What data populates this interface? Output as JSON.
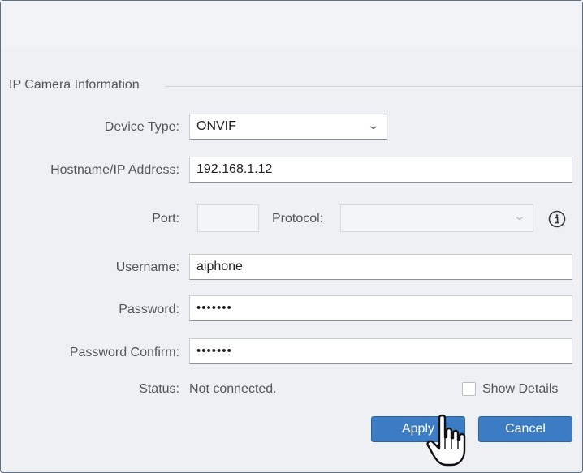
{
  "section": {
    "title": "IP Camera Information"
  },
  "device_type": {
    "label": "Device Type:",
    "value": "ONVIF"
  },
  "hostname": {
    "label": "Hostname/IP Address:",
    "value": "192.168.1.12"
  },
  "port": {
    "label": "Port:",
    "value": ""
  },
  "protocol": {
    "label": "Protocol:",
    "value": ""
  },
  "username": {
    "label": "Username:",
    "value": "aiphone"
  },
  "password": {
    "label": "Password:",
    "value": "•••••••"
  },
  "password_confirm": {
    "label": "Password Confirm:",
    "value": "•••••••"
  },
  "status": {
    "label": "Status:",
    "value": "Not connected."
  },
  "show_details": {
    "label": "Show Details",
    "checked": false
  },
  "buttons": {
    "apply": "Apply",
    "cancel": "Cancel"
  },
  "colors": {
    "button": "#3b7cc4",
    "background": "#eef0f3",
    "border": "#5f7185"
  },
  "icons": [
    "info-icon",
    "chevron-down-icon",
    "hand-cursor-icon"
  ]
}
